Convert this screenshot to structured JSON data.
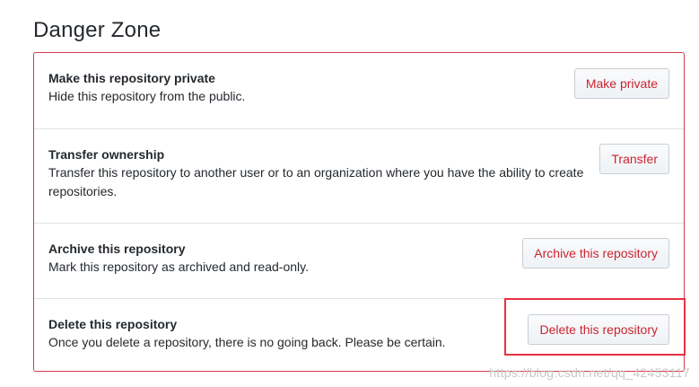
{
  "title": "Danger Zone",
  "items": [
    {
      "title": "Make this repository private",
      "description": "Hide this repository from the public.",
      "button": "Make private"
    },
    {
      "title": "Transfer ownership",
      "description": "Transfer this repository to another user or to an organization where you have the ability to create repositories.",
      "button": "Transfer"
    },
    {
      "title": "Archive this repository",
      "description": "Mark this repository as archived and read-only.",
      "button": "Archive this repository"
    },
    {
      "title": "Delete this repository",
      "description": "Once you delete a repository, there is no going back. Please be certain.",
      "button": "Delete this repository"
    }
  ],
  "watermark": "https://blog.csdn.net/qq_42453117",
  "colors": {
    "danger": "#cb2431",
    "zone_border": "#d73a49",
    "highlight": "#e5333f"
  }
}
